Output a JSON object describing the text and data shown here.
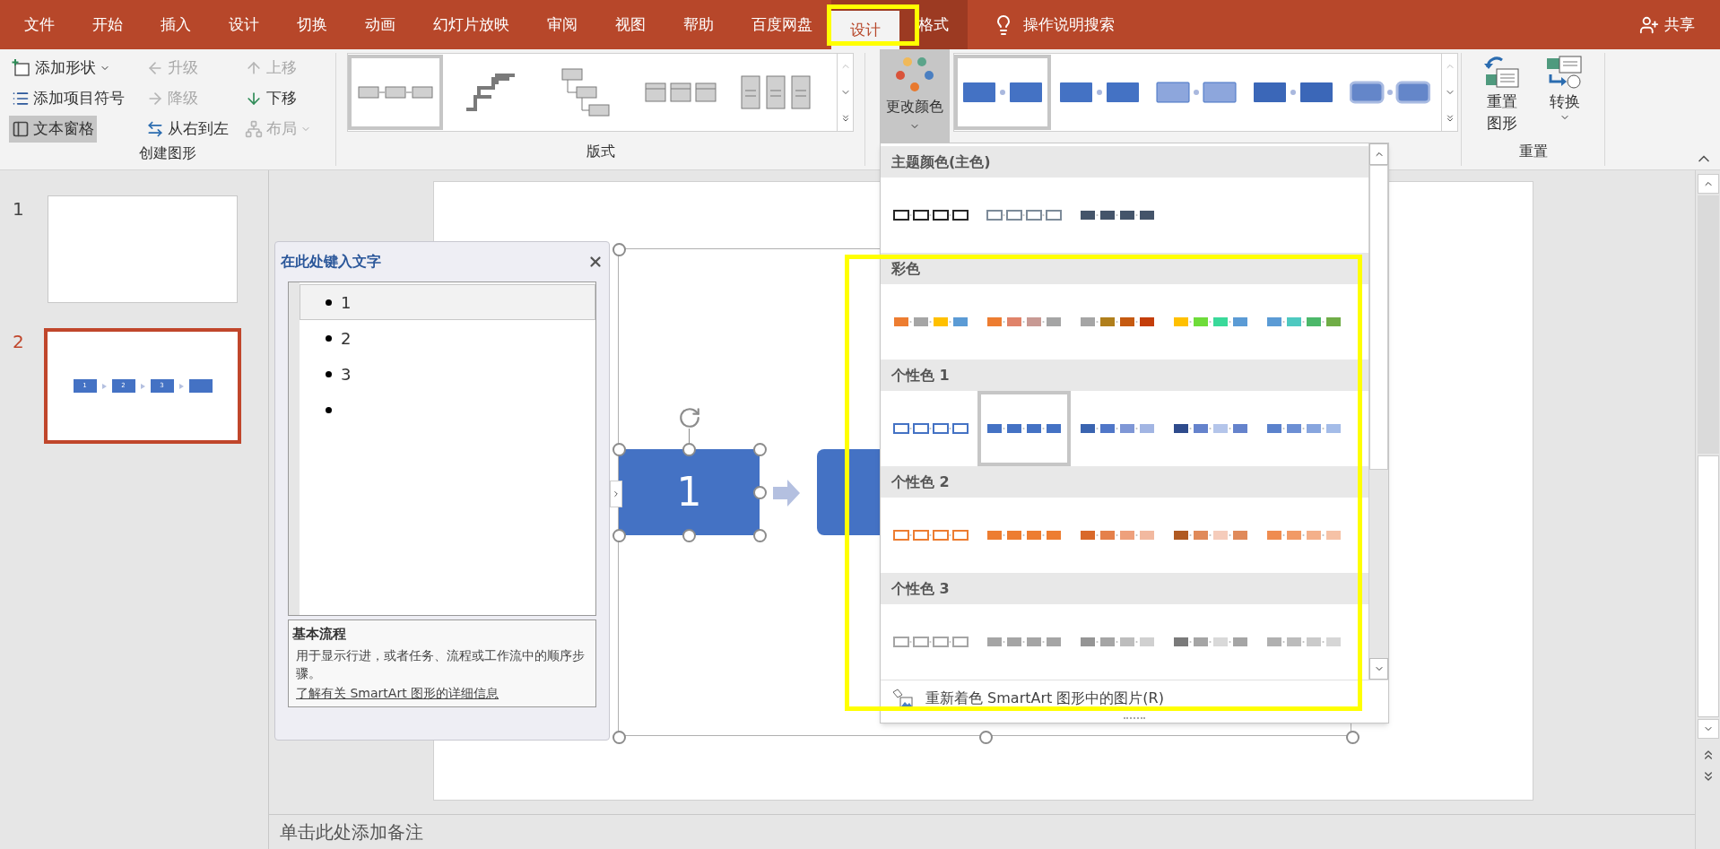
{
  "tabs": [
    {
      "label": "文件",
      "selected": false,
      "contextual": false
    },
    {
      "label": "开始",
      "selected": false,
      "contextual": false
    },
    {
      "label": "插入",
      "selected": false,
      "contextual": false
    },
    {
      "label": "设计",
      "selected": false,
      "contextual": false
    },
    {
      "label": "切换",
      "selected": false,
      "contextual": false
    },
    {
      "label": "动画",
      "selected": false,
      "contextual": false
    },
    {
      "label": "幻灯片放映",
      "selected": false,
      "contextual": false
    },
    {
      "label": "审阅",
      "selected": false,
      "contextual": false
    },
    {
      "label": "视图",
      "selected": false,
      "contextual": false
    },
    {
      "label": "帮助",
      "selected": false,
      "contextual": false
    },
    {
      "label": "百度网盘",
      "selected": false,
      "contextual": false
    },
    {
      "label": "设计",
      "selected": true,
      "contextual": true
    },
    {
      "label": "格式",
      "selected": false,
      "contextual": true
    }
  ],
  "tell_me": "操作说明搜索",
  "share": "共享",
  "ribbon": {
    "create": {
      "label": "创建图形",
      "buttons": [
        {
          "label": "添加形状",
          "kind": "add-shape",
          "disabled": false,
          "pressed": false,
          "menu": true
        },
        {
          "label": "升级",
          "kind": "promote",
          "disabled": true,
          "pressed": false,
          "menu": false
        },
        {
          "label": "上移",
          "kind": "move-up",
          "disabled": true,
          "pressed": false,
          "menu": false
        },
        {
          "label": "添加项目符号",
          "kind": "bullets",
          "disabled": false,
          "pressed": false,
          "menu": false
        },
        {
          "label": "降级",
          "kind": "demote",
          "disabled": true,
          "pressed": false,
          "menu": false
        },
        {
          "label": "下移",
          "kind": "move-down",
          "disabled": false,
          "pressed": false,
          "menu": false
        },
        {
          "label": "文本窗格",
          "kind": "text-pane",
          "disabled": false,
          "pressed": true,
          "menu": false
        },
        {
          "label": "从右到左",
          "kind": "right-to-left",
          "disabled": false,
          "pressed": false,
          "menu": false
        },
        {
          "label": "布局",
          "kind": "layout",
          "disabled": true,
          "pressed": false,
          "menu": true
        }
      ]
    },
    "layouts": {
      "label": "版式",
      "items": [
        {
          "kind": "basic-process",
          "selected": true
        },
        {
          "kind": "step-up",
          "selected": false
        },
        {
          "kind": "hierarchy",
          "selected": false
        },
        {
          "kind": "process-list",
          "selected": false
        },
        {
          "kind": "detailed-process",
          "selected": false
        }
      ]
    },
    "change_colors": {
      "label": "更改颜色",
      "pressed": true
    },
    "styles": {
      "items": [
        {
          "kind": "flat",
          "selected": true
        },
        {
          "kind": "subtle",
          "selected": false
        },
        {
          "kind": "light",
          "selected": false
        },
        {
          "kind": "shaded",
          "selected": false
        },
        {
          "kind": "soft",
          "selected": false
        }
      ]
    },
    "reset": {
      "label": "重置",
      "buttons": [
        {
          "label": "重置图形",
          "kind": "reset",
          "menu": false
        },
        {
          "label": "转换",
          "kind": "convert",
          "menu": true
        }
      ]
    }
  },
  "slides": [
    {
      "number": "1",
      "selected": false
    },
    {
      "number": "2",
      "selected": true,
      "boxes": [
        {
          "kind": "labeled",
          "label": "1"
        },
        {
          "kind": "labeled",
          "label": "2"
        },
        {
          "kind": "labeled",
          "label": "3"
        },
        {
          "kind": "blank"
        }
      ]
    }
  ],
  "text_pane": {
    "title": "在此处键入文字",
    "items": [
      {
        "text": "1",
        "selected": true
      },
      {
        "text": "2",
        "selected": false
      },
      {
        "text": "3",
        "selected": false
      },
      {
        "selected": false
      }
    ],
    "info": {
      "title": "基本流程",
      "description": "用于显示行进，或者任务、流程或工作流中的顺序步骤。",
      "link": "了解有关 SmartArt 图形的详细信息"
    }
  },
  "diagram": {
    "nodes": [
      {
        "label": "1",
        "selected": true
      },
      {
        "selected": false
      }
    ]
  },
  "color_menu": {
    "sections": [
      {
        "title": "主题颜色(主色)",
        "swatches": [
          {
            "kind": "outline",
            "selected": false,
            "boxes": [
              {
                "color": "#262626"
              },
              {
                "color": "#262626"
              },
              {
                "color": "#262626"
              },
              {
                "color": "#262626"
              }
            ]
          },
          {
            "kind": "outline",
            "selected": false,
            "boxes": [
              {
                "color": "#7d8b99"
              },
              {
                "color": "#7d8b99"
              },
              {
                "color": "#7d8b99"
              },
              {
                "color": "#7d8b99"
              }
            ]
          },
          {
            "kind": "fill",
            "selected": false,
            "boxes": [
              {
                "color": "#44546a"
              },
              {
                "color": "#44546a"
              },
              {
                "color": "#44546a"
              },
              {
                "color": "#44546a"
              }
            ]
          }
        ]
      },
      {
        "title": "彩色",
        "swatches": [
          {
            "kind": "fill",
            "selected": false,
            "boxes": [
              {
                "color": "#ed7d31"
              },
              {
                "color": "#a5a5a5"
              },
              {
                "color": "#ffc000"
              },
              {
                "color": "#5b9bd5"
              }
            ]
          },
          {
            "kind": "fill",
            "selected": false,
            "boxes": [
              {
                "color": "#ed7d31"
              },
              {
                "color": "#e0836a"
              },
              {
                "color": "#c89a94"
              },
              {
                "color": "#a5a5a5"
              }
            ]
          },
          {
            "kind": "fill",
            "selected": false,
            "boxes": [
              {
                "color": "#a5a5a5"
              },
              {
                "color": "#b07f1c"
              },
              {
                "color": "#c55a11"
              },
              {
                "color": "#c43e0a"
              }
            ]
          },
          {
            "kind": "fill",
            "selected": false,
            "boxes": [
              {
                "color": "#ffc000"
              },
              {
                "color": "#6fdc3a"
              },
              {
                "color": "#3ad99a"
              },
              {
                "color": "#5b9bd5"
              }
            ]
          },
          {
            "kind": "fill",
            "selected": false,
            "boxes": [
              {
                "color": "#5b9bd5"
              },
              {
                "color": "#4ec9c0"
              },
              {
                "color": "#4cb86a"
              },
              {
                "color": "#70ad47"
              }
            ]
          }
        ]
      },
      {
        "title": "个性色 1",
        "swatches": [
          {
            "kind": "outline",
            "selected": false,
            "boxes": [
              {
                "color": "#4472c4"
              },
              {
                "color": "#4472c4"
              },
              {
                "color": "#4472c4"
              },
              {
                "color": "#4472c4"
              }
            ]
          },
          {
            "kind": "fill",
            "selected": true,
            "boxes": [
              {
                "color": "#4472c4"
              },
              {
                "color": "#4472c4"
              },
              {
                "color": "#4472c4"
              },
              {
                "color": "#4472c4"
              }
            ]
          },
          {
            "kind": "fill",
            "selected": false,
            "boxes": [
              {
                "color": "#3a64b0"
              },
              {
                "color": "#5077c8"
              },
              {
                "color": "#7f97d6"
              },
              {
                "color": "#a2b5e3"
              }
            ]
          },
          {
            "kind": "fill",
            "selected": false,
            "boxes": [
              {
                "color": "#2e4b8c"
              },
              {
                "color": "#6583cc"
              },
              {
                "color": "#b4c5ea"
              },
              {
                "color": "#6583cc"
              }
            ]
          },
          {
            "kind": "fill",
            "selected": false,
            "boxes": [
              {
                "color": "#5b82cc"
              },
              {
                "color": "#6c8fd4"
              },
              {
                "color": "#87a5de"
              },
              {
                "color": "#a4bce8"
              }
            ]
          }
        ]
      },
      {
        "title": "个性色 2",
        "swatches": [
          {
            "kind": "outline",
            "selected": false,
            "boxes": [
              {
                "color": "#ed7d31"
              },
              {
                "color": "#ed7d31"
              },
              {
                "color": "#ed7d31"
              },
              {
                "color": "#ed7d31"
              }
            ]
          },
          {
            "kind": "fill",
            "selected": false,
            "boxes": [
              {
                "color": "#ed7d31"
              },
              {
                "color": "#ed7d31"
              },
              {
                "color": "#ed7d31"
              },
              {
                "color": "#ed7d31"
              }
            ]
          },
          {
            "kind": "fill",
            "selected": false,
            "boxes": [
              {
                "color": "#d9692a"
              },
              {
                "color": "#e5804a"
              },
              {
                "color": "#eea07c"
              },
              {
                "color": "#f2b9a0"
              }
            ]
          },
          {
            "kind": "fill",
            "selected": false,
            "boxes": [
              {
                "color": "#b05a22"
              },
              {
                "color": "#e08a5a"
              },
              {
                "color": "#f5ccbb"
              },
              {
                "color": "#e08a5a"
              }
            ]
          },
          {
            "kind": "fill",
            "selected": false,
            "boxes": [
              {
                "color": "#ef8c50"
              },
              {
                "color": "#f19a66"
              },
              {
                "color": "#f4b08a"
              },
              {
                "color": "#f6c2a6"
              }
            ]
          }
        ]
      },
      {
        "title": "个性色 3",
        "swatches": [
          {
            "kind": "outline",
            "selected": false,
            "boxes": [
              {
                "color": "#a5a5a5"
              },
              {
                "color": "#a5a5a5"
              },
              {
                "color": "#a5a5a5"
              },
              {
                "color": "#a5a5a5"
              }
            ]
          },
          {
            "kind": "fill",
            "selected": false,
            "boxes": [
              {
                "color": "#a5a5a5"
              },
              {
                "color": "#a5a5a5"
              },
              {
                "color": "#a5a5a5"
              },
              {
                "color": "#a5a5a5"
              }
            ]
          },
          {
            "kind": "fill",
            "selected": false,
            "boxes": [
              {
                "color": "#959595"
              },
              {
                "color": "#a5a5a5"
              },
              {
                "color": "#bdbdbd"
              },
              {
                "color": "#d0d0d0"
              }
            ]
          },
          {
            "kind": "fill",
            "selected": false,
            "boxes": [
              {
                "color": "#7a7a7a"
              },
              {
                "color": "#a5a5a5"
              },
              {
                "color": "#d9d9d9"
              },
              {
                "color": "#a5a5a5"
              }
            ]
          },
          {
            "kind": "fill",
            "selected": false,
            "boxes": [
              {
                "color": "#b0b0b0"
              },
              {
                "color": "#bcbcbc"
              },
              {
                "color": "#cacaca"
              },
              {
                "color": "#d6d6d6"
              }
            ]
          }
        ]
      }
    ],
    "footer": "重新着色 SmartArt 图形中的图片(R)"
  },
  "notes": {
    "placeholder": "单击此处添加备注"
  }
}
